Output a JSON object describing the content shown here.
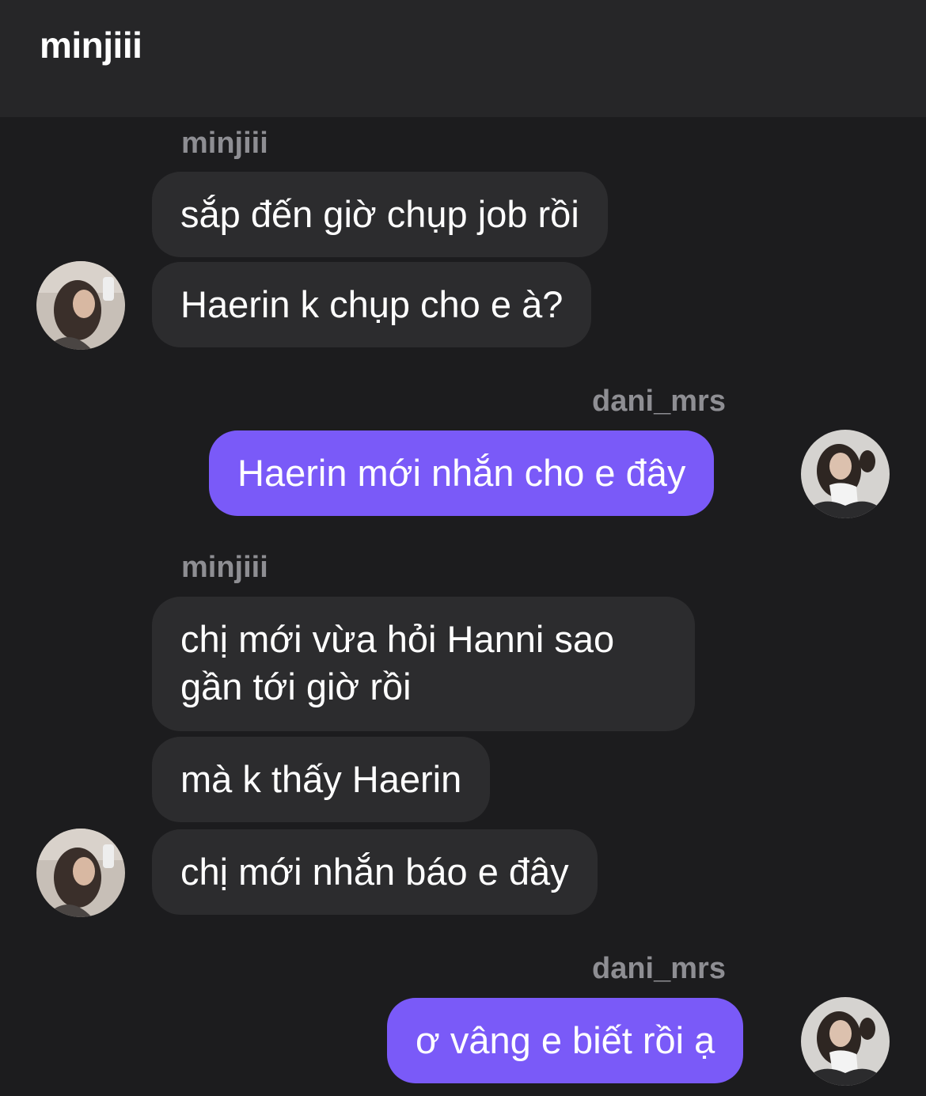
{
  "header": {
    "title": "minjiii"
  },
  "messages": [
    {
      "sender": "minjiii",
      "direction": "in",
      "texts": [
        "sắp đến giờ chụp job rồi",
        "Haerin k chụp cho e à?"
      ],
      "avatar": "avatar-minjiii"
    },
    {
      "sender": "dani_mrs",
      "direction": "out",
      "texts": [
        "Haerin mới nhắn cho e đây"
      ],
      "avatar": "avatar-dani"
    },
    {
      "sender": "minjiii",
      "direction": "in",
      "texts": [
        "chị mới vừa hỏi Hanni sao",
        "gần tới giờ rồi",
        "mà k thấy Haerin",
        "chị mới nhắn báo e đây"
      ],
      "avatar": "avatar-minjiii"
    },
    {
      "sender": "dani_mrs",
      "direction": "out",
      "texts": [
        "ơ vâng e biết rồi ạ"
      ],
      "avatar": "avatar-dani"
    }
  ],
  "colors": {
    "background": "#1c1c1e",
    "header": "#262628",
    "incoming_bubble": "#2c2c2e",
    "outgoing_bubble": "#7a5af8",
    "sender_label": "#8e8e93"
  }
}
